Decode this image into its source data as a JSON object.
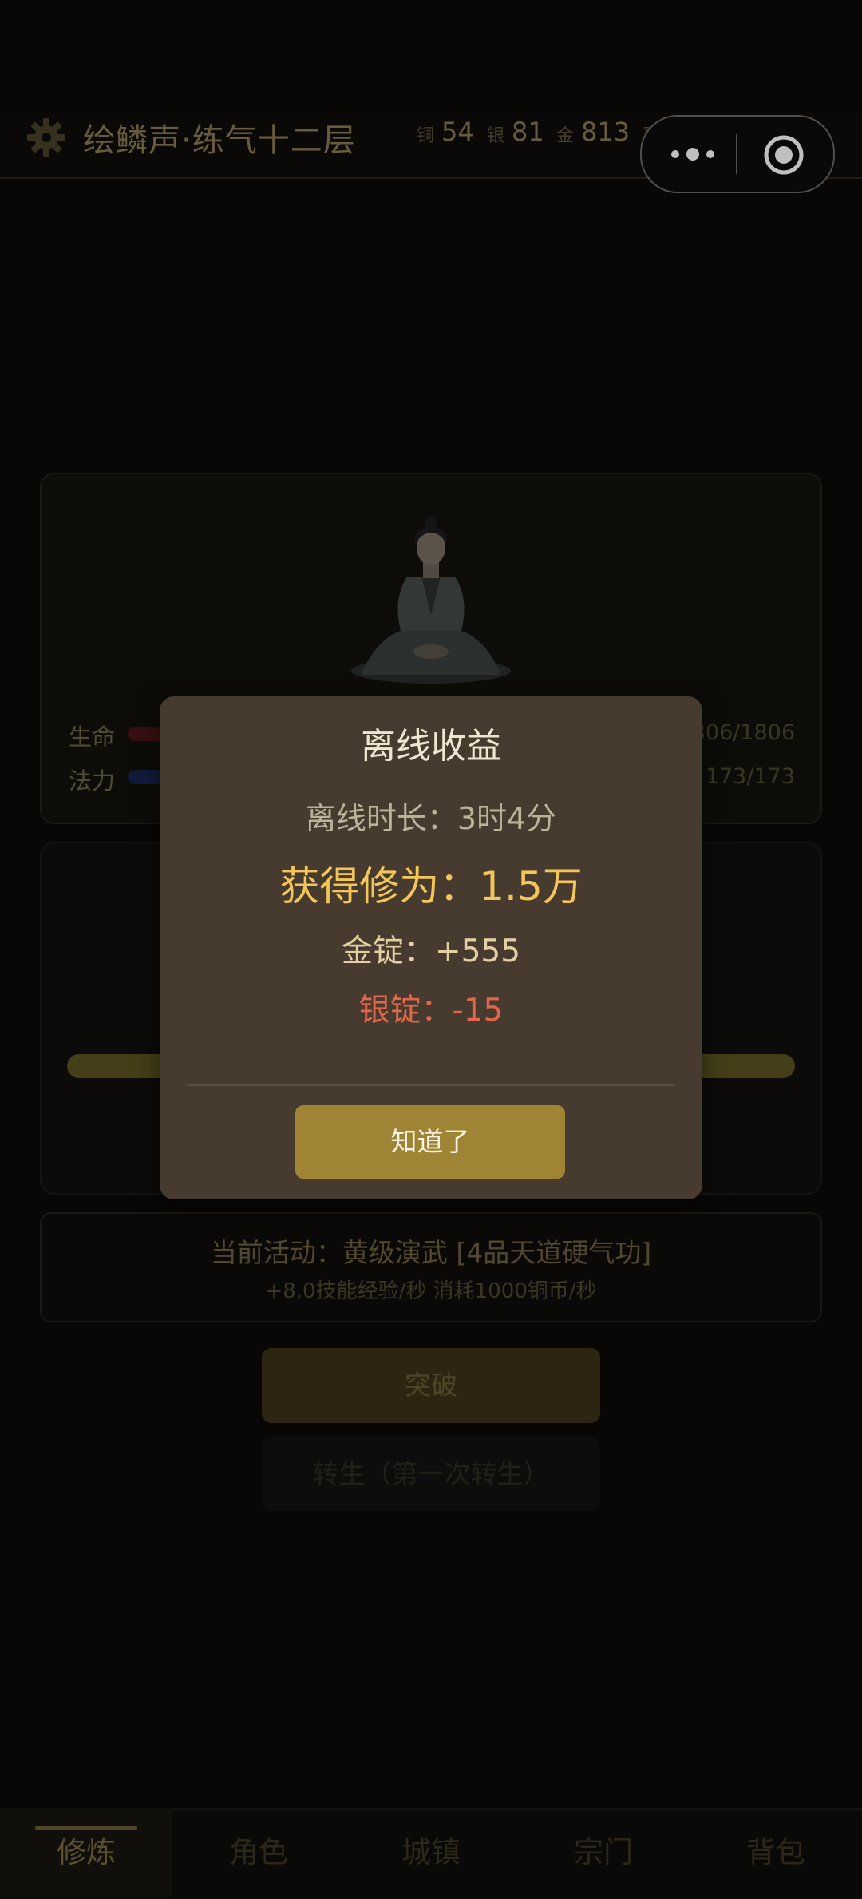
{
  "header": {
    "title": "绘鳞声·练气十二层",
    "currency": [
      {
        "label": "铜",
        "value": "54"
      },
      {
        "label": "银",
        "value": "81"
      },
      {
        "label": "金",
        "value": "813"
      },
      {
        "label": "灵",
        "value": "46"
      }
    ]
  },
  "capsule": {
    "more_icon": "more-dots-icon",
    "close_icon": "record-circle-icon"
  },
  "character": {
    "hp_label": "生命",
    "hp_value": "1806/1806",
    "mp_label": "法力",
    "mp_value": "173/173",
    "hp_color": "#8a1f28",
    "mp_color": "#2a3f8a"
  },
  "activity": {
    "line1": "当前活动：黄级演武 [4品天道硬气功]",
    "line2": "+8.0技能经验/秒  消耗1000铜币/秒"
  },
  "buttons": {
    "breakthrough": "突破",
    "reincarnate": "转生（第一次转生）"
  },
  "tabs": [
    "修炼",
    "角色",
    "城镇",
    "宗门",
    "背包"
  ],
  "modal": {
    "title": "离线收益",
    "duration": "离线时长：3时4分",
    "gain": "获得修为：1.5万",
    "gold": "金锭：+555",
    "silver": "银锭：-15",
    "confirm": "知道了"
  }
}
